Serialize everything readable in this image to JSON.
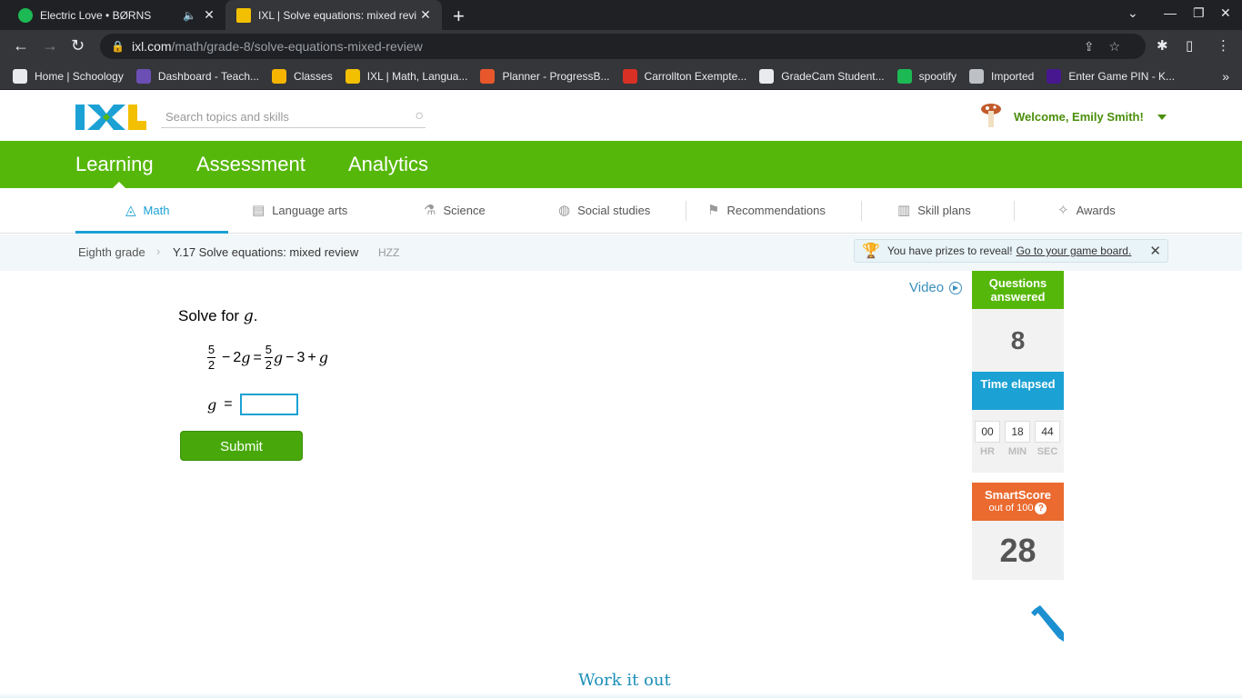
{
  "browser": {
    "tabs": [
      {
        "title": "Electric Love • BØRNS",
        "active": false,
        "favicon_color": "#1db954"
      },
      {
        "title": "IXL | Solve equations: mixed revi",
        "active": true,
        "favicon_color": "#f2c000"
      }
    ],
    "url_host": "ixl.com",
    "url_path": "/math/grade-8/solve-equations-mixed-review",
    "bookmarks": [
      {
        "label": "Home | Schoology",
        "color": "#e8eaed"
      },
      {
        "label": "Dashboard - Teach...",
        "color": "#6c4fb5"
      },
      {
        "label": "Classes",
        "color": "#f4b400"
      },
      {
        "label": "IXL | Math, Langua...",
        "color": "#f2c000"
      },
      {
        "label": "Planner - ProgressB...",
        "color": "#e8572c"
      },
      {
        "label": "Carrollton Exempte...",
        "color": "#d93025"
      },
      {
        "label": "GradeCam Student...",
        "color": "#e8eaed"
      },
      {
        "label": "spootify",
        "color": "#1db954"
      },
      {
        "label": "Imported",
        "color": "#bdc1c6"
      },
      {
        "label": "Enter Game PIN - K...",
        "color": "#46178f"
      }
    ]
  },
  "header": {
    "search_placeholder": "Search topics and skills",
    "welcome": "Welcome, Emily Smith!"
  },
  "main_nav": [
    "Learning",
    "Assessment",
    "Analytics"
  ],
  "sub_nav": [
    {
      "label": "Math",
      "icon": "pyramid-icon"
    },
    {
      "label": "Language arts",
      "icon": "book-icon"
    },
    {
      "label": "Science",
      "icon": "flask-icon"
    },
    {
      "label": "Social studies",
      "icon": "globe-icon"
    },
    {
      "label": "Recommendations",
      "icon": "signpost-icon"
    },
    {
      "label": "Skill plans",
      "icon": "clipboard-icon"
    },
    {
      "label": "Awards",
      "icon": "awards-icon"
    }
  ],
  "breadcrumb": {
    "grade": "Eighth grade",
    "skill": "Y.17 Solve equations: mixed review",
    "code": "HZZ"
  },
  "prize_banner": {
    "text": "You have prizes to reveal!",
    "link": "Go to your game board."
  },
  "question": {
    "prompt_prefix": "Solve for ",
    "variable": "g",
    "prompt_suffix": ".",
    "lhs_frac_num": "5",
    "lhs_frac_den": "2",
    "lhs_rest_op": "−",
    "lhs_coef": "2",
    "equals": "=",
    "rhs_frac_num": "5",
    "rhs_frac_den": "2",
    "rhs_op1": "−",
    "rhs_const": "3",
    "rhs_op2": "+",
    "answer_eq": "="
  },
  "submit_label": "Submit",
  "video_label": "Video",
  "stats": {
    "questions_answered_label": "Questions answered",
    "questions_answered": "8",
    "time_elapsed_label": "Time elapsed",
    "time": [
      {
        "value": "00",
        "unit": "HR"
      },
      {
        "value": "18",
        "unit": "MIN"
      },
      {
        "value": "44",
        "unit": "SEC"
      }
    ],
    "smartscore_label": "SmartScore",
    "smartscore_sub": "out of 100",
    "smartscore": "28"
  },
  "work_it_out": "Work it out",
  "colors": {
    "ixl_green": "#56b70b",
    "ixl_blue": "#1ba1d4",
    "smartscore_orange": "#ea6a2f"
  }
}
